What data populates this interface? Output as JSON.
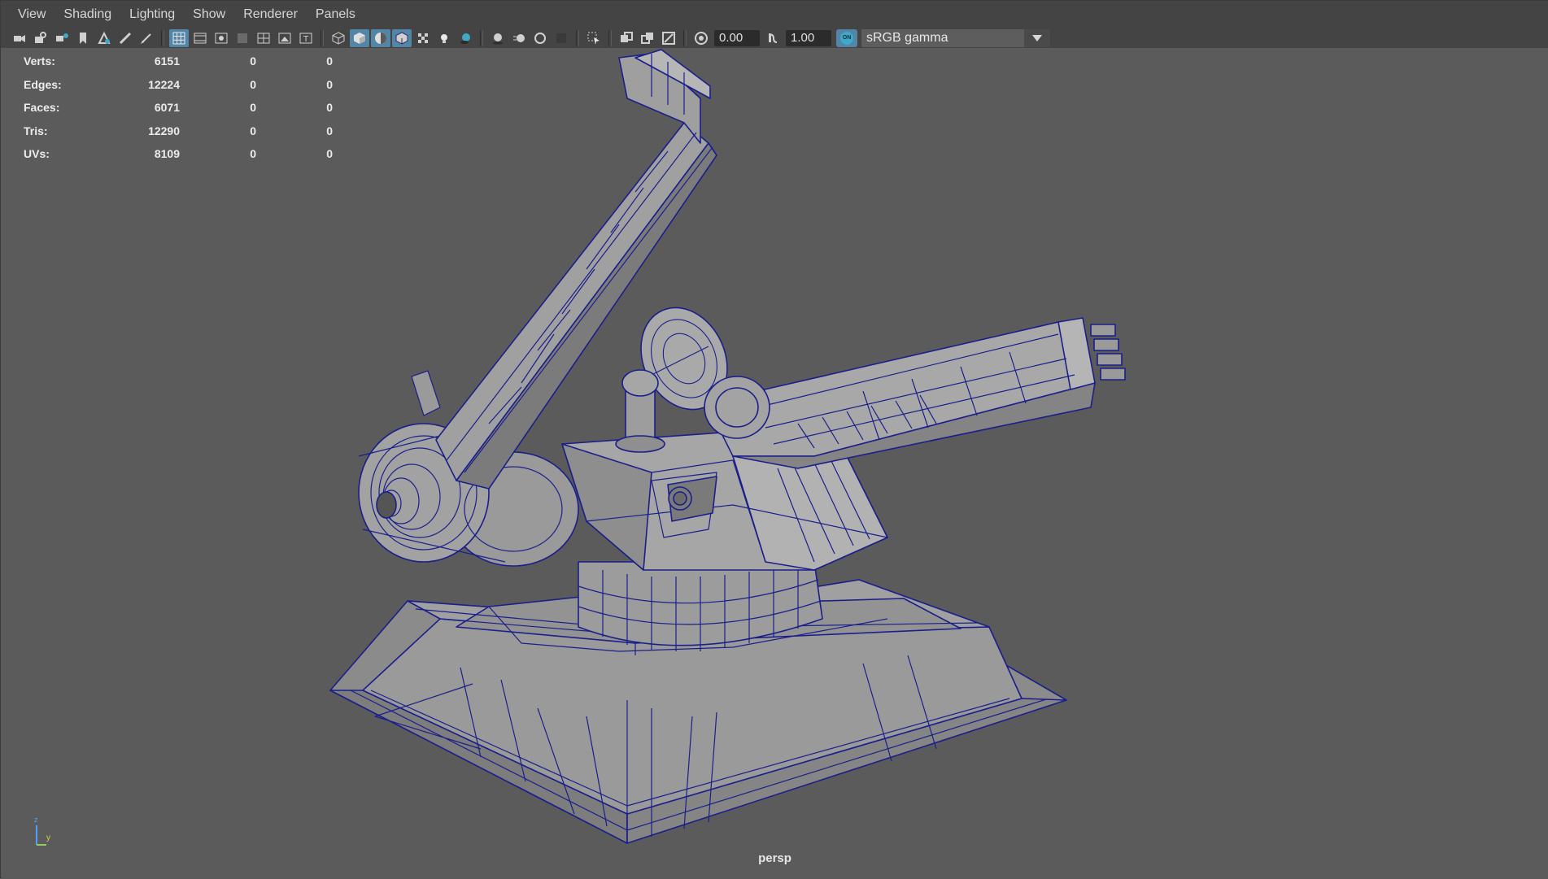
{
  "menu": [
    "View",
    "Shading",
    "Lighting",
    "Show",
    "Renderer",
    "Panels"
  ],
  "toolbar": {
    "exposure_value": "0.00",
    "gamma_value": "1.00",
    "color_mgmt_toggle": "ON",
    "view_transform": "sRGB gamma"
  },
  "hud": {
    "rows": [
      {
        "label": "Verts:",
        "v1": "6151",
        "v2": "0",
        "v3": "0"
      },
      {
        "label": "Edges:",
        "v1": "12224",
        "v2": "0",
        "v3": "0"
      },
      {
        "label": "Faces:",
        "v1": "6071",
        "v2": "0",
        "v3": "0"
      },
      {
        "label": "Tris:",
        "v1": "12290",
        "v2": "0",
        "v3": "0"
      },
      {
        "label": "UVs:",
        "v1": "8109",
        "v2": "0",
        "v3": "0"
      }
    ]
  },
  "axis": {
    "z": "z",
    "y": "y"
  },
  "camera": "persp",
  "colors": {
    "wireframe": "#1a1f8a",
    "mesh": "#8c8c8c",
    "active_tool": "#5285a6",
    "background": "#5b5b5b"
  }
}
